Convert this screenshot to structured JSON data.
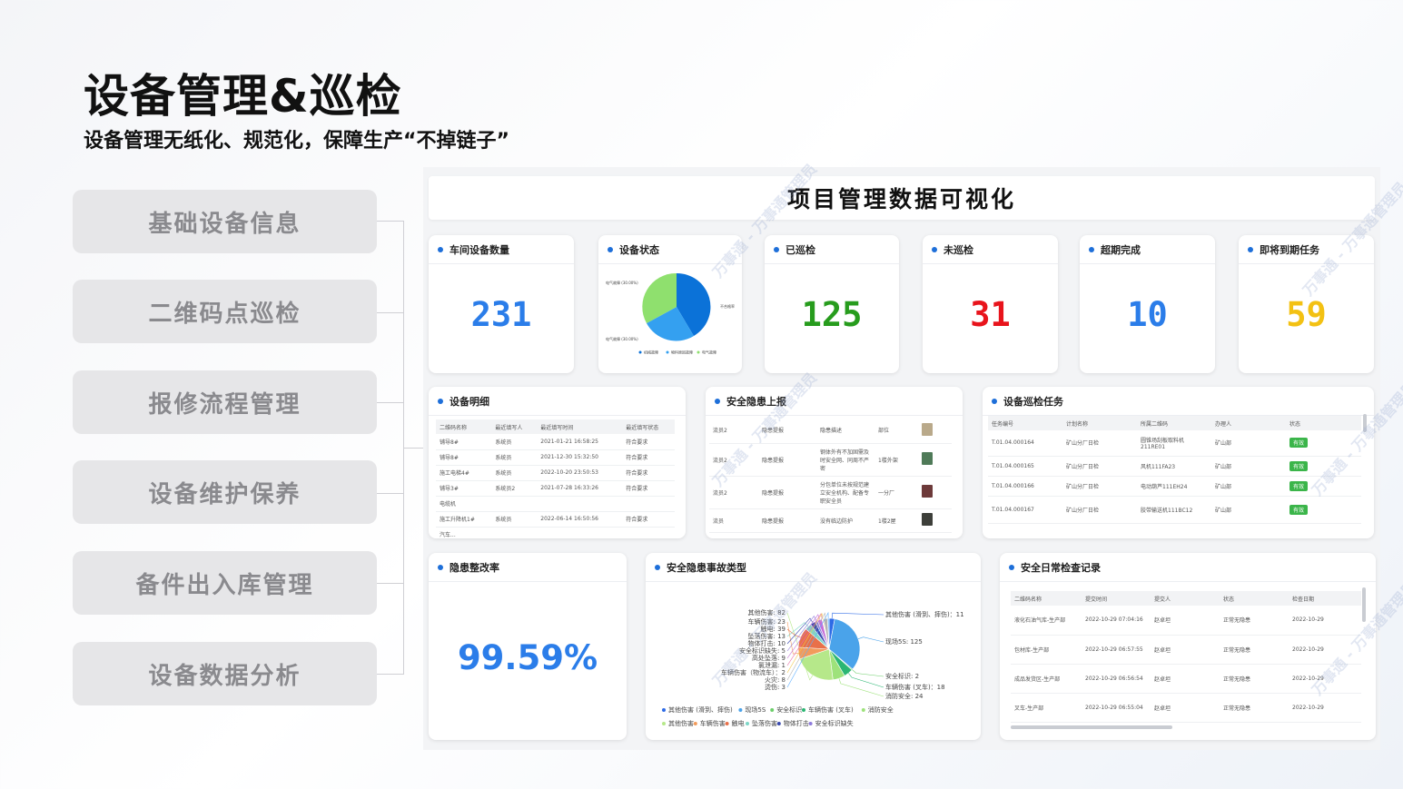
{
  "page": {
    "title": "设备管理&巡检",
    "subtitle": "设备管理无纸化、规范化，保障生产“不掉链子”"
  },
  "menu": [
    {
      "label": "基础设备信息"
    },
    {
      "label": "二维码点巡检"
    },
    {
      "label": "报修流程管理"
    },
    {
      "label": "设备维护保养"
    },
    {
      "label": "备件出入库管理"
    },
    {
      "label": "设备数据分析"
    }
  ],
  "dashboard": {
    "title": "项目管理数据可视化",
    "watermark": "万事通 - 万事通管理员",
    "colors": {
      "blue": "#2b7de9",
      "green": "#279c1d",
      "red": "#e8141c",
      "yellow": "#f3c113",
      "accent": "#1e6fd9"
    },
    "stats": [
      {
        "label": "车间设备数量",
        "value": "231",
        "color": "#2b7de9"
      },
      {
        "label": "已巡检",
        "value": "125",
        "color": "#279c1d"
      },
      {
        "label": "未巡检",
        "value": "31",
        "color": "#e8141c"
      },
      {
        "label": "超期完成",
        "value": "10",
        "color": "#2b7de9"
      },
      {
        "label": "即将到期任务",
        "value": "59",
        "color": "#f3c113"
      }
    ],
    "device_status": {
      "label": "设备状态",
      "slice_labels": [
        "电气故障 (30.00%)",
        "不合格率",
        "电气故障 (30.00%)"
      ],
      "legend": [
        "机械故障",
        "物料原因故障",
        "电气故障"
      ]
    },
    "device_detail": {
      "label": "设备明细",
      "columns": [
        "二维码名称",
        "最近填写人",
        "最近填写时间",
        "最近填写状态"
      ],
      "rows": [
        [
          "铺导8#",
          "系统员",
          "2021-01-21 16:58:25",
          "符合要求"
        ],
        [
          "铺导8#",
          "系统员",
          "2021-12-30 15:32:50",
          "符合要求"
        ],
        [
          "施工电梯4#",
          "系统员",
          "2022-10-20 23:50:53",
          "符合要求"
        ],
        [
          "铺导3#",
          "系统员2",
          "2021-07-28 16:33:26",
          "符合要求"
        ],
        [
          "电缆机",
          "",
          "",
          ""
        ],
        [
          "施工升降机1#",
          "系统员",
          "2022-06-14 16:50:56",
          "符合要求"
        ],
        [
          "汽车...",
          "",
          "",
          ""
        ]
      ]
    },
    "hazard_report": {
      "label": "安全隐患上报",
      "rows": [
        {
          "loc": "流员2",
          "type": "隐患提报",
          "desc": "隐患描述",
          "area": "部位",
          "thumb": "#b9a98a"
        },
        {
          "loc": "流员2",
          "type": "隐患提报",
          "desc": "钢体外有不加固需及时安全网、同周不严密",
          "area": "1楼外架",
          "thumb": "#4f7a58"
        },
        {
          "loc": "流员2",
          "type": "隐患提报",
          "desc": "分包单位未按规范建立安全机构、配备专职安全员",
          "area": "一分厂",
          "thumb": "#6d3a3a"
        },
        {
          "loc": "流员",
          "type": "隐患提报",
          "desc": "没有临边防护",
          "area": "1楼2屋",
          "thumb": "#3d3f3a"
        }
      ]
    },
    "patrol_tasks": {
      "label": "设备巡检任务",
      "columns": [
        "任务编号",
        "计划名称",
        "所属二维码",
        "办理人",
        "状态"
      ],
      "rows": [
        [
          "T.01.04.000164",
          "矿山分厂日检",
          "圆锥场刮板取料机211RE01",
          "矿山部",
          "有效"
        ],
        [
          "T.01.04.000165",
          "矿山分厂日检",
          "风机111FA23",
          "矿山部",
          "有效"
        ],
        [
          "T.01.04.000166",
          "矿山分厂日检",
          "电动葫芦111EH24",
          "矿山部",
          "有效"
        ],
        [
          "T.01.04.000167",
          "矿山分厂日检",
          "胶带输送机111BC12",
          "矿山部",
          "有效"
        ]
      ]
    },
    "rectification": {
      "label": "隐患整改率",
      "value": "99.59%",
      "color": "#2b7de9"
    },
    "accident_types": {
      "label": "安全隐患事故类型",
      "chart_data": {
        "type": "pie",
        "title": "",
        "categories": [
          "其他伤害 (滑到、摔伤)",
          "现场5S",
          "安全标识",
          "车辆伤害 (叉车)",
          "消防安全",
          "其他伤害",
          "车辆伤害",
          "触电",
          "坠落伤害",
          "物体打击",
          "安全标识缺失",
          "高处坠落",
          "氯泄漏",
          "车辆伤害 (物流车)",
          "火灾",
          "烫伤"
        ],
        "values": [
          11,
          125,
          2,
          18,
          24,
          82,
          23,
          39,
          13,
          10,
          5,
          9,
          1,
          2,
          8,
          3
        ],
        "colors": [
          "#2e6be6",
          "#4aa3ea",
          "#6dcf6b",
          "#2bb673",
          "#9ee27b",
          "#b6e88a",
          "#f29b5b",
          "#e8704a",
          "#7ed7c8",
          "#3b4bb0",
          "#8e7bdc",
          "#c46fd8",
          "#e86fa8",
          "#f2c94c",
          "#b3b3b3",
          "#5fb0ff"
        ],
        "labels": [
          "其他伤害 (滑到、摔伤)：11",
          "现场5S: 125",
          "安全标识: 2",
          "车辆伤害 (叉车)：18",
          "消防安全: 24",
          "其他伤害: 82",
          "车辆伤害: 23",
          "触电: 39",
          "坠落伤害: 13",
          "物体打击: 10",
          "安全标识缺失: 5",
          "高处坠落: 9",
          "氯泄漏: 1",
          "车辆伤害（物流车）：2",
          "火灾: 8",
          "烫伤: 3"
        ],
        "legend": [
          "其他伤害 (滑到、摔伤)",
          "现场5S",
          "安全标识",
          "车辆伤害 (叉车)",
          "消防安全",
          "其他伤害",
          "车辆伤害",
          "触电",
          "坠落伤害",
          "物体打击",
          "安全标识缺失"
        ],
        "legend_position": "bottom"
      }
    },
    "daily_check": {
      "label": "安全日常检查记录",
      "columns": [
        "二维码名称",
        "提交时间",
        "提交人",
        "状态",
        "检查日期"
      ],
      "rows": [
        [
          "液化石油气库-生产部",
          "2022-10-29 07:04:16",
          "赵卓坦",
          "正常无隐患",
          "2022-10-29"
        ],
        [
          "包材库-生产部",
          "2022-10-29 06:57:55",
          "赵卓坦",
          "正常无隐患",
          "2022-10-29"
        ],
        [
          "成品发货区-生产部",
          "2022-10-29 06:56:54",
          "赵卓坦",
          "正常无隐患",
          "2022-10-29"
        ],
        [
          "叉车-生产部",
          "2022-10-29 06:55:04",
          "赵卓坦",
          "正常无隐患",
          "2022-10-29"
        ]
      ]
    }
  }
}
